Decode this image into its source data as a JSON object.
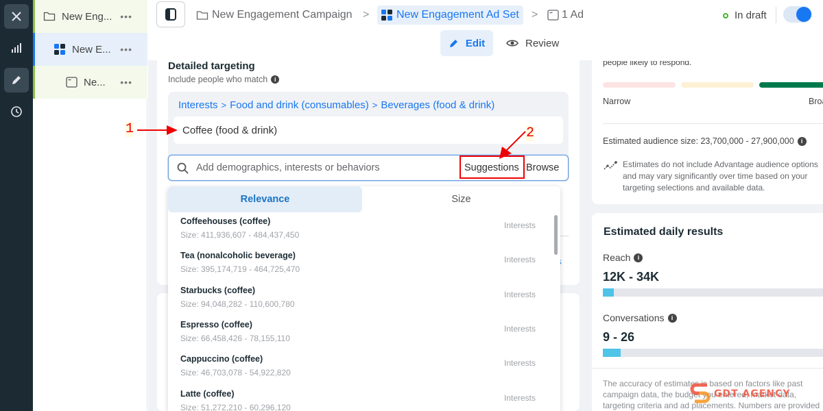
{
  "rail": {
    "close": "close-icon",
    "items": [
      "chart-icon",
      "pencil-icon",
      "clock-icon"
    ]
  },
  "tree": {
    "items": [
      {
        "label": "New Eng...",
        "icon": "folder-icon",
        "more": "•••"
      },
      {
        "label": "New E...",
        "icon": "adset-grid-icon",
        "more": "•••"
      },
      {
        "label": "Ne...",
        "icon": "ad-window-icon",
        "more": "•••"
      }
    ]
  },
  "header": {
    "breadcrumb": [
      {
        "label": "New Engagement Campaign",
        "icon": "folder-icon"
      },
      {
        "label": "New Engagement Ad Set",
        "icon": "adset-grid-icon"
      },
      {
        "label": "1 Ad",
        "icon": "ad-window-icon"
      }
    ],
    "separator": ">",
    "status": "In draft",
    "toggle_on": true
  },
  "tabs": {
    "edit": "Edit",
    "review": "Review"
  },
  "targeting": {
    "title": "Detailed targeting",
    "subtitle": "Include people who match",
    "path": [
      "Interests",
      "Food and drink (consumables)",
      "Beverages (food & drink)"
    ],
    "path_sep": ">",
    "selected": "Coffee (food & drink)",
    "search_placeholder": "Add demographics, interests or behaviors",
    "suggestions_label": "Suggestions",
    "browse_label": "Browse",
    "partial_link": "ns"
  },
  "dropdown": {
    "tabs": [
      {
        "label": "Relevance",
        "active": true
      },
      {
        "label": "Size",
        "active": false
      }
    ],
    "items": [
      {
        "title": "Coffeehouses (coffee)",
        "size": "Size: 411,936,607 - 484,437,450",
        "category": "Interests"
      },
      {
        "title": "Tea (nonalcoholic beverage)",
        "size": "Size: 395,174,719 - 464,725,470",
        "category": "Interests"
      },
      {
        "title": "Starbucks (coffee)",
        "size": "Size: 94,048,282 - 110,600,780",
        "category": "Interests"
      },
      {
        "title": "Espresso (coffee)",
        "size": "Size: 66,458,426 - 78,155,110",
        "category": "Interests"
      },
      {
        "title": "Cappuccino (coffee)",
        "size": "Size: 46,703,078 - 54,922,820",
        "category": "Interests"
      },
      {
        "title": "Latte (coffee)",
        "size": "Size: 51,272,210 - 60,296,120",
        "category": "Interests"
      }
    ]
  },
  "audience": {
    "cut_text": "people likely to respond.",
    "narrow": "Narrow",
    "broad": "Broad",
    "size_text": "Estimated audience size: 23,700,000 - 27,900,000",
    "note_bold": "Estimates do not include Advantage audience options",
    "note_rest": " and may vary significantly over time based on your targeting selections and available data."
  },
  "daily": {
    "title": "Estimated daily results",
    "metrics": [
      {
        "label": "Reach",
        "value": "12K - 34K",
        "fill_pct": 1.5
      },
      {
        "label": "Conversations",
        "value": "9 - 26",
        "fill_pct": 8
      }
    ],
    "footer": "The accuracy of estimates is based on factors like past campaign data, the budget you entered, market data, targeting criteria and ad placements. Numbers are provided"
  },
  "annotations": {
    "one": "1",
    "two": "2"
  },
  "watermark": "GDT AGENCY",
  "colors": {
    "brand_blue": "#1877f2",
    "link_blue": "#216fdb",
    "active_tab_bg": "#e7f0fa",
    "draft_green": "#42b72a",
    "bar_green": "#007a4d",
    "meter_blue": "#4fc3e8",
    "annotation_red": "#e00000"
  }
}
